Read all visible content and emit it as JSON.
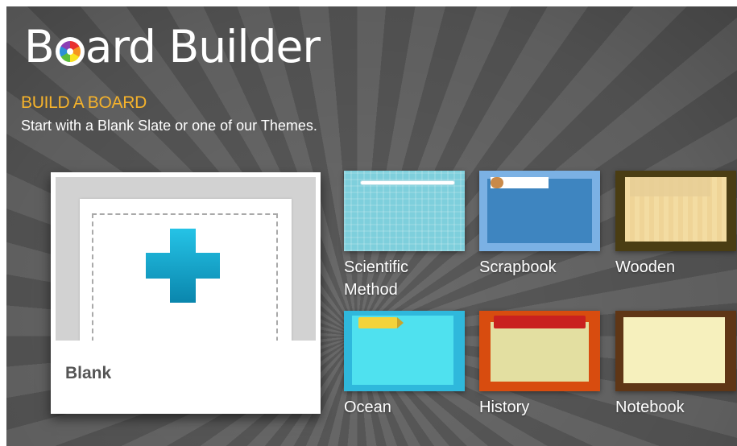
{
  "app": {
    "logo_prefix": "B",
    "logo_suffix": "ard Builder",
    "logo_icon": "color-wheel-icon"
  },
  "intro": {
    "heading": "BUILD A BOARD",
    "subheading": "Start with a Blank Slate or one of our Themes."
  },
  "blank": {
    "label": "Blank",
    "icon": "plus-icon"
  },
  "themes": [
    {
      "label_line1": "Scientific",
      "label_line2": "Method"
    },
    {
      "label_line1": "Scrapbook",
      "label_line2": ""
    },
    {
      "label_line1": "Wooden",
      "label_line2": ""
    },
    {
      "label_line1": "Ocean",
      "label_line2": ""
    },
    {
      "label_line1": "History",
      "label_line2": ""
    },
    {
      "label_line1": "Notebook",
      "label_line2": ""
    }
  ],
  "colors": {
    "heading_accent": "#f6b32b",
    "plus_icon": "#0fa3c9"
  }
}
